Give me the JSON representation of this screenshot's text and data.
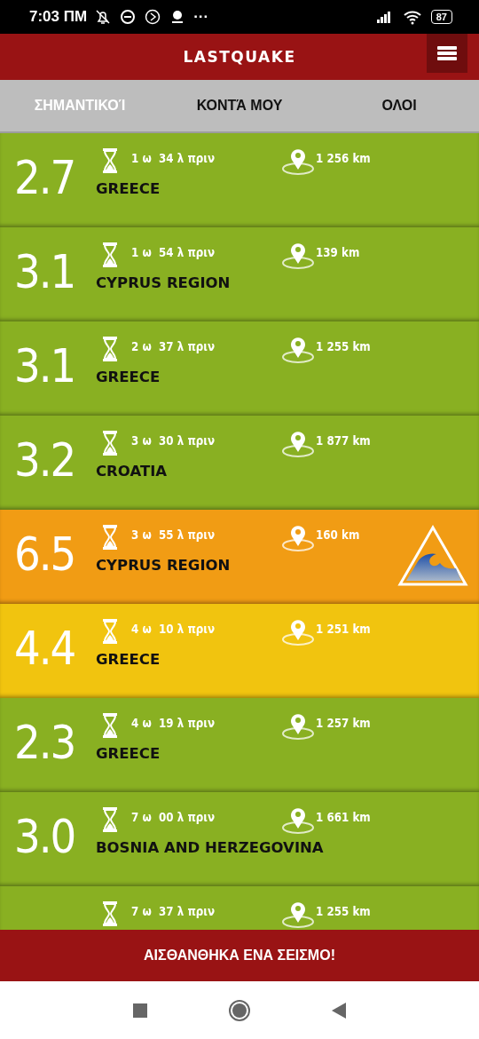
{
  "status_bar": {
    "time": "7:03 ΠΜ",
    "more": "···",
    "battery": "87"
  },
  "header": {
    "title": "LASTQUAKE"
  },
  "tabs": [
    {
      "label": "ΣΗΜΑΝΤΙΚΟΊ",
      "selected": true
    },
    {
      "label": "ΚΟΝΤΆ ΜΟΥ",
      "selected": false
    },
    {
      "label": "ΟΛΟΙ",
      "selected": false
    }
  ],
  "quakes": [
    {
      "magnitude": "2.7",
      "time_ago": "1 ω  34 λ πριν",
      "distance": "1 256 km",
      "region": "GREECE",
      "color": "#89b022",
      "tsunami": false
    },
    {
      "magnitude": "3.1",
      "time_ago": "1 ω  54 λ πριν",
      "distance": "139 km",
      "region": "CYPRUS REGION",
      "color": "#89b022",
      "tsunami": false
    },
    {
      "magnitude": "3.1",
      "time_ago": "2 ω  37 λ πριν",
      "distance": "1 255 km",
      "region": "GREECE",
      "color": "#89b022",
      "tsunami": false
    },
    {
      "magnitude": "3.2",
      "time_ago": "3 ω  30 λ πριν",
      "distance": "1 877 km",
      "region": "CROATIA",
      "color": "#89b022",
      "tsunami": false
    },
    {
      "magnitude": "6.5",
      "time_ago": "3 ω  55 λ πριν",
      "distance": "160 km",
      "region": "CYPRUS REGION",
      "color": "#f19c14",
      "tsunami": true
    },
    {
      "magnitude": "4.4",
      "time_ago": "4 ω  10 λ πριν",
      "distance": "1 251 km",
      "region": "GREECE",
      "color": "#f1c40f",
      "tsunami": false
    },
    {
      "magnitude": "2.3",
      "time_ago": "4 ω  19 λ πριν",
      "distance": "1 257 km",
      "region": "GREECE",
      "color": "#89b022",
      "tsunami": false
    },
    {
      "magnitude": "3.0",
      "time_ago": "7 ω  00 λ πριν",
      "distance": "1 661 km",
      "region": "BOSNIA AND HERZEGOVINA",
      "color": "#89b022",
      "tsunami": false
    },
    {
      "time_ago": "7 ω  37 λ πριν",
      "distance": "1 255 km",
      "color": "#89b022",
      "tsunami": false
    }
  ],
  "felt_button": {
    "label": "ΑΙΣΘΑΝΘΗΚΑ ΕΝΑ ΣΕΙΣΜΟ!"
  }
}
